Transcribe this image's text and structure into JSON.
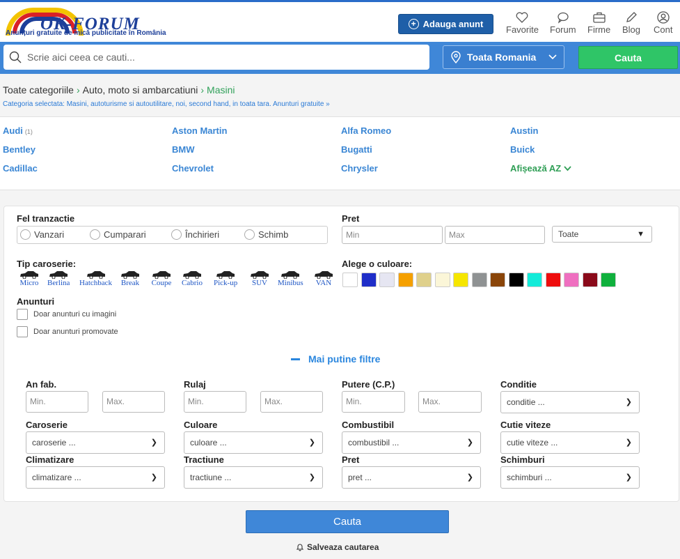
{
  "header": {
    "logo_name": "OK-FORUM",
    "logo_tagline": "Anunțuri gratuite de mică publicitate în România",
    "add_button": "Adauga anunt",
    "nav": [
      {
        "label": "Favorite",
        "icon": "heart-icon"
      },
      {
        "label": "Forum",
        "icon": "chat-icon"
      },
      {
        "label": "Firme",
        "icon": "briefcase-icon"
      },
      {
        "label": "Blog",
        "icon": "pencil-icon"
      },
      {
        "label": "Cont",
        "icon": "user-icon"
      }
    ]
  },
  "search": {
    "placeholder": "Scrie aici ceea ce cauti...",
    "location": "Toata Romania",
    "button": "Cauta"
  },
  "breadcrumb": {
    "items": [
      "Toate categoriile",
      "Auto, moto si ambarcatiuni",
      "Masini"
    ],
    "description": "Categoria selectata: Masini, autoturisme si autoutilitare, noi, second hand, in toata tara. Anunturi gratuite »"
  },
  "brands": [
    {
      "name": "Audi",
      "count": "(1)"
    },
    {
      "name": "Aston Martin"
    },
    {
      "name": "Alfa Romeo"
    },
    {
      "name": "Austin"
    },
    {
      "name": "Bentley"
    },
    {
      "name": "BMW"
    },
    {
      "name": "Bugatti"
    },
    {
      "name": "Buick"
    },
    {
      "name": "Cadillac"
    },
    {
      "name": "Chevrolet"
    },
    {
      "name": "Chrysler"
    },
    {
      "name": "Afișează AZ"
    }
  ],
  "filters": {
    "tranzactie_label": "Fel tranzactie",
    "tranzactie_options": [
      "Vanzari",
      "Cumparari",
      "Închirieri",
      "Schimb"
    ],
    "pret_label": "Pret",
    "pret_min": "Min",
    "pret_max": "Max",
    "pret_select": "Toate",
    "caroserie_label": "Tip caroserie:",
    "body_types": [
      "Micro",
      "Berlina",
      "Hatchback",
      "Break",
      "Coupe",
      "Cabrio",
      "Pick-up",
      "SUV",
      "Minibus",
      "VAN"
    ],
    "color_label": "Alege o culoare:",
    "colors": [
      "#ffffff",
      "#1f2ec8",
      "#e6e6f2",
      "#f5a000",
      "#dfd08b",
      "#fbf6d8",
      "#f6e600",
      "#8f9293",
      "#8a4509",
      "#000000",
      "#14ebd9",
      "#ee0d0d",
      "#ef6fc0",
      "#8a0a1a",
      "#10b03d"
    ],
    "anunturi_label": "Anunturi",
    "only_images": "Doar anunturi cu imagini",
    "only_promoted": "Doar anunturi promovate",
    "less_filters": "Mai putine filtre",
    "an_fab": {
      "label": "An fab.",
      "min": "Min.",
      "max": "Max."
    },
    "rulaj": {
      "label": "Rulaj",
      "min": "Min.",
      "max": "Max."
    },
    "putere": {
      "label": "Putere (C.P.)",
      "min": "Min.",
      "max": "Max."
    },
    "conditie": {
      "label": "Conditie",
      "value": "conditie ..."
    },
    "caroserie": {
      "label": "Caroserie",
      "value": "caroserie ..."
    },
    "culoare": {
      "label": "Culoare",
      "value": "culoare ..."
    },
    "combustibil": {
      "label": "Combustibil",
      "value": "combustibil ..."
    },
    "cutie": {
      "label": "Cutie viteze",
      "value": "cutie viteze ..."
    },
    "climatizare": {
      "label": "Climatizare",
      "value": "climatizare ..."
    },
    "tractiune": {
      "label": "Tractiune",
      "value": "tractiune ..."
    },
    "pret2": {
      "label": "Pret",
      "value": "pret ..."
    },
    "schimburi": {
      "label": "Schimburi",
      "value": "schimburi ..."
    }
  },
  "submit_button": "Cauta",
  "save_search": "Salveaza cautarea"
}
